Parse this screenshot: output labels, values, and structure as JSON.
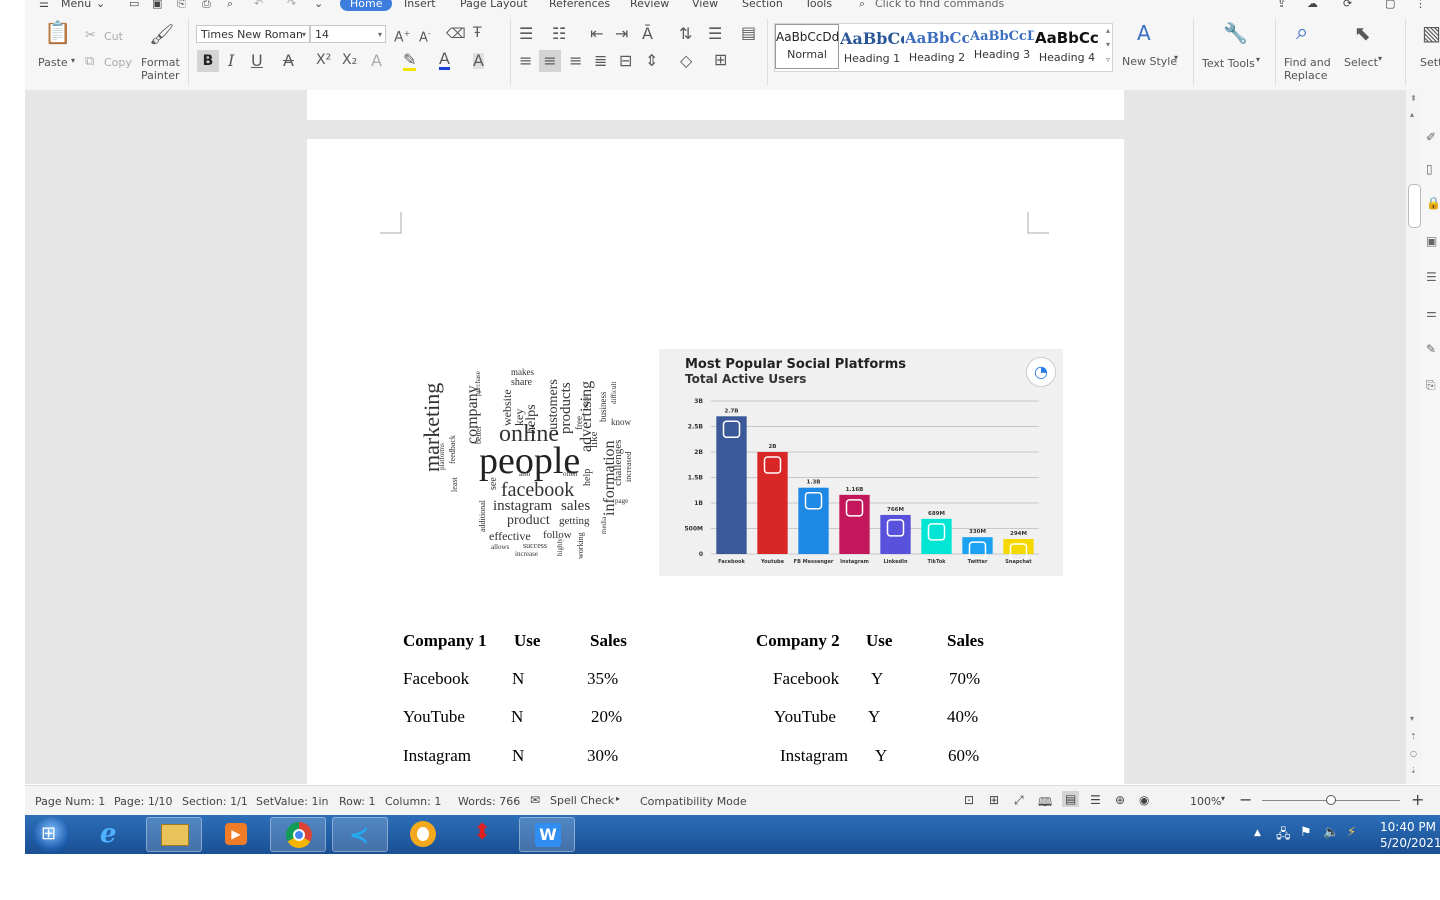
{
  "menu": {
    "menu_label": "Menu",
    "tabs": [
      "Home",
      "Insert",
      "Page Layout",
      "References",
      "Review",
      "View",
      "Section",
      "Tools"
    ],
    "search_placeholder": "Click to find commands"
  },
  "ribbon": {
    "paste": "Paste",
    "cut": "Cut",
    "copy": "Copy",
    "format_painter_1": "Format",
    "format_painter_2": "Painter",
    "font_name": "Times New Roman",
    "font_size": "14",
    "styles": [
      {
        "preview": "AaBbCcDd",
        "name": "Normal"
      },
      {
        "preview": "AaBbCᴄ",
        "name": "Heading 1"
      },
      {
        "preview": "AaBbCc",
        "name": "Heading 2"
      },
      {
        "preview": "AaBbCcD",
        "name": "Heading 3"
      },
      {
        "preview": "AaBbCcI",
        "name": "Heading 4"
      }
    ],
    "new_style": "New Style",
    "text_tools": "Text Tools",
    "find_replace_1": "Find and",
    "find_replace_2": "Replace",
    "select": "Select",
    "settings": "Setting"
  },
  "document": {
    "word_cloud": [
      "people",
      "marketing",
      "online",
      "company",
      "facebook",
      "instagram",
      "sales",
      "product",
      "information",
      "advertising",
      "customers",
      "products",
      "helps",
      "website",
      "key",
      "share",
      "makes",
      "purchase",
      "better",
      "feedback",
      "platforms",
      "least",
      "additional",
      "see",
      "also",
      "effective",
      "follow",
      "getting",
      "allows",
      "success",
      "increase",
      "highly",
      "working",
      "media",
      "page",
      "challenges",
      "increased",
      "know",
      "like",
      "business",
      "difficult",
      "begin",
      "free",
      "help",
      "often"
    ],
    "table1": {
      "headers": [
        "Company 1",
        "Use",
        "Sales"
      ],
      "rows": [
        [
          "Facebook",
          "N",
          "35%"
        ],
        [
          "YouTube",
          "N",
          "20%"
        ],
        [
          "Instagram",
          "N",
          "30%"
        ]
      ]
    },
    "table2": {
      "headers": [
        "Company 2",
        "Use",
        "Sales"
      ],
      "rows": [
        [
          "Facebook",
          "Y",
          "70%"
        ],
        [
          "YouTube",
          "Y",
          "40%"
        ],
        [
          "Instagram",
          "Y",
          "60%"
        ]
      ]
    }
  },
  "chart_data": {
    "type": "bar",
    "title": "Most Popular Social Platforms",
    "subtitle": "Total Active Users",
    "categories": [
      "Facebook",
      "Youtube",
      "FB Messenger",
      "Instagram",
      "LinkedIn",
      "TikTok",
      "Twitter",
      "Snapchat"
    ],
    "values": [
      2.7,
      2.0,
      1.3,
      1.16,
      0.766,
      0.689,
      0.33,
      0.294
    ],
    "data_labels": [
      "2.7B",
      "2B",
      "1.3B",
      "1.16B",
      "766M",
      "689M",
      "330M",
      "294M"
    ],
    "yticks": [
      "0",
      "500M",
      "1B",
      "1.5B",
      "2B",
      "2.5B",
      "3B"
    ],
    "ylim": [
      0,
      3
    ],
    "colors": [
      "#3b5998",
      "#d92626",
      "#1e88e5",
      "#c2185b",
      "#5851db",
      "#00e5d4",
      "#1da1f2",
      "#f5d800"
    ],
    "icons": [
      "facebook-icon",
      "youtube-icon",
      "messenger-icon",
      "instagram-icon",
      "linkedin-icon",
      "tiktok-icon",
      "twitter-icon",
      "snapchat-icon"
    ],
    "grid": true
  },
  "status": {
    "page_num": "Page Num: 1",
    "page": "Page: 1/10",
    "section": "Section: 1/1",
    "setvalue": "SetValue: 1in",
    "row": "Row: 1",
    "column": "Column: 1",
    "words": "Words: 766",
    "spell_check": "Spell Check",
    "compat": "Compatibility Mode",
    "zoom": "100%",
    "zoom_level": 0.5
  },
  "taskbar": {
    "time": "10:40 PM",
    "date": "5/20/2021"
  }
}
